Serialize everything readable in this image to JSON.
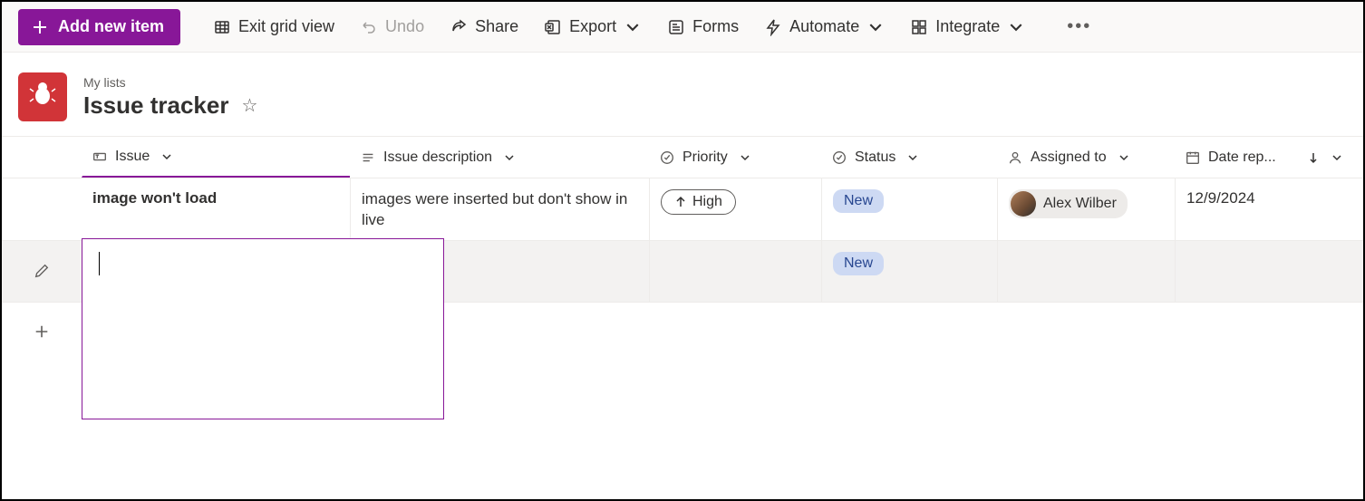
{
  "toolbar": {
    "add_label": "Add new item",
    "exit_grid": "Exit grid view",
    "undo": "Undo",
    "share": "Share",
    "export": "Export",
    "forms": "Forms",
    "automate": "Automate",
    "integrate": "Integrate"
  },
  "header": {
    "breadcrumb": "My lists",
    "title": "Issue tracker"
  },
  "columns": {
    "issue": "Issue",
    "description": "Issue description",
    "priority": "Priority",
    "status": "Status",
    "assigned": "Assigned to",
    "date": "Date rep..."
  },
  "rows": [
    {
      "issue": "image won't load",
      "description": "images were inserted but don't show in live",
      "priority": "High",
      "status": "New",
      "assigned": "Alex Wilber",
      "date": "12/9/2024"
    },
    {
      "issue": "",
      "description": "",
      "priority": "",
      "status": "New",
      "assigned": "",
      "date": ""
    }
  ],
  "colors": {
    "primary": "#881798",
    "status_bg": "#cdd9f3",
    "status_fg": "#274690"
  }
}
